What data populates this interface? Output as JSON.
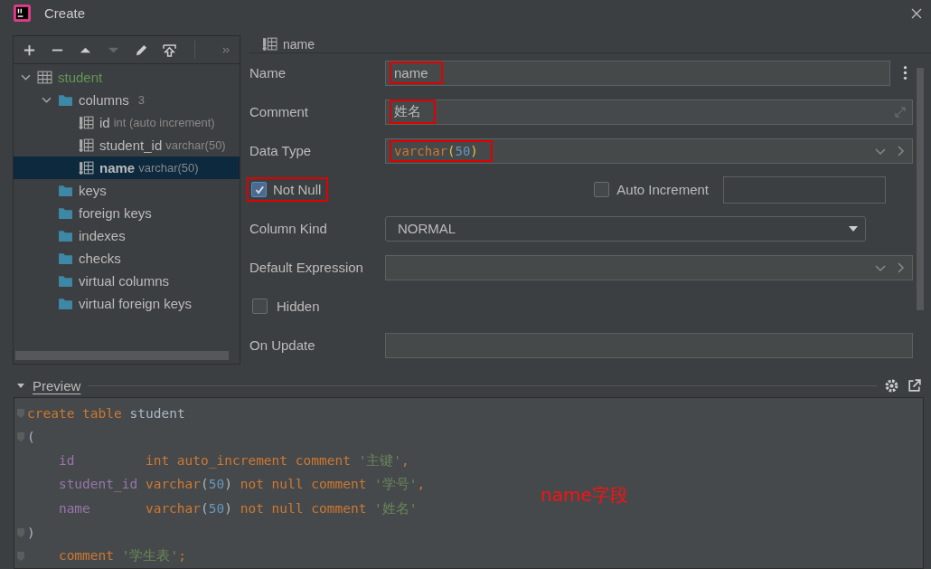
{
  "window": {
    "title": "Create"
  },
  "tree": [
    {
      "label": "student",
      "kind": "table",
      "expanded": true,
      "selected": false,
      "children": [
        {
          "label": "columns",
          "count": "3",
          "kind": "folder",
          "expanded": true,
          "selected": false,
          "children": [
            {
              "label": "id",
              "detail": "int (auto increment)",
              "kind": "column",
              "selected": false
            },
            {
              "label": "student_id",
              "detail": "varchar(50)",
              "kind": "column",
              "selected": false
            },
            {
              "label": "name",
              "detail": "varchar(50)",
              "kind": "column",
              "selected": true
            }
          ]
        },
        {
          "label": "keys",
          "kind": "folder",
          "selected": false
        },
        {
          "label": "foreign keys",
          "kind": "folder",
          "selected": false
        },
        {
          "label": "indexes",
          "kind": "folder",
          "selected": false
        },
        {
          "label": "checks",
          "kind": "folder",
          "selected": false
        },
        {
          "label": "virtual columns",
          "kind": "folder",
          "selected": false
        },
        {
          "label": "virtual foreign keys",
          "kind": "folder",
          "selected": false
        }
      ]
    }
  ],
  "detail": {
    "title": "name"
  },
  "form": [
    {
      "kind": "text",
      "label": "Name",
      "value": "name",
      "highlighted": true,
      "more": true
    },
    {
      "kind": "expandable",
      "label": "Comment",
      "value": "姓名",
      "highlighted": true
    },
    {
      "kind": "type",
      "label": "Data Type",
      "highlighted": true,
      "tokens": [
        {
          "kind": "keyword",
          "text": "varchar"
        },
        {
          "kind": "paren",
          "text": "("
        },
        {
          "kind": "number",
          "text": "50"
        },
        {
          "kind": "paren",
          "text": ")"
        }
      ]
    },
    {
      "kind": "checkpair",
      "label": "Not Null",
      "checked": true,
      "highlighted": true,
      "label2": "Auto Increment",
      "checked2": false
    },
    {
      "kind": "select",
      "label": "Column Kind",
      "value": "NORMAL"
    },
    {
      "kind": "combo",
      "label": "Default Expression"
    },
    {
      "kind": "checkbox",
      "label": "Hidden",
      "checked": false
    },
    {
      "kind": "text",
      "label": "On Update"
    }
  ],
  "preview": {
    "title": "Preview",
    "expanded": true,
    "lines": [
      {
        "fold": true,
        "indent": false,
        "tokens": [
          {
            "kind": "keyword",
            "text": "create table "
          },
          {
            "kind": "ident",
            "text": "student"
          }
        ]
      },
      {
        "fold": true,
        "indent": false,
        "tokens": [
          {
            "kind": "ident",
            "text": "("
          }
        ]
      },
      {
        "fold": false,
        "indent": true,
        "tokens": [
          {
            "kind": "field",
            "text": "id"
          },
          {
            "kind": "keyword",
            "text": "int auto_increment comment "
          },
          {
            "kind": "string",
            "text": "'主键'"
          },
          {
            "kind": "keyword",
            "text": ","
          }
        ]
      },
      {
        "fold": false,
        "indent": true,
        "tokens": [
          {
            "kind": "field",
            "text": "student_id"
          },
          {
            "kind": "keyword",
            "text": "varchar"
          },
          {
            "kind": "ident",
            "text": "("
          },
          {
            "kind": "number",
            "text": "50"
          },
          {
            "kind": "ident",
            "text": ")"
          },
          {
            "kind": "keyword",
            "text": " not null comment "
          },
          {
            "kind": "string",
            "text": "'学号'"
          },
          {
            "kind": "keyword",
            "text": ","
          }
        ]
      },
      {
        "fold": false,
        "indent": true,
        "tokens": [
          {
            "kind": "field",
            "text": "name"
          },
          {
            "kind": "keyword",
            "text": "varchar"
          },
          {
            "kind": "ident",
            "text": "("
          },
          {
            "kind": "number",
            "text": "50"
          },
          {
            "kind": "ident",
            "text": ")"
          },
          {
            "kind": "keyword",
            "text": " not null comment "
          },
          {
            "kind": "string",
            "text": "'姓名'"
          }
        ]
      },
      {
        "fold": true,
        "indent": false,
        "tokens": [
          {
            "kind": "ident",
            "text": ")"
          }
        ]
      },
      {
        "fold": true,
        "indent": true,
        "tokens": [
          {
            "kind": "keyword",
            "text": "comment "
          },
          {
            "kind": "string",
            "text": "'学生表'"
          },
          {
            "kind": "keyword",
            "text": ";"
          }
        ]
      }
    ]
  },
  "annotation": {
    "text": "name字段"
  }
}
